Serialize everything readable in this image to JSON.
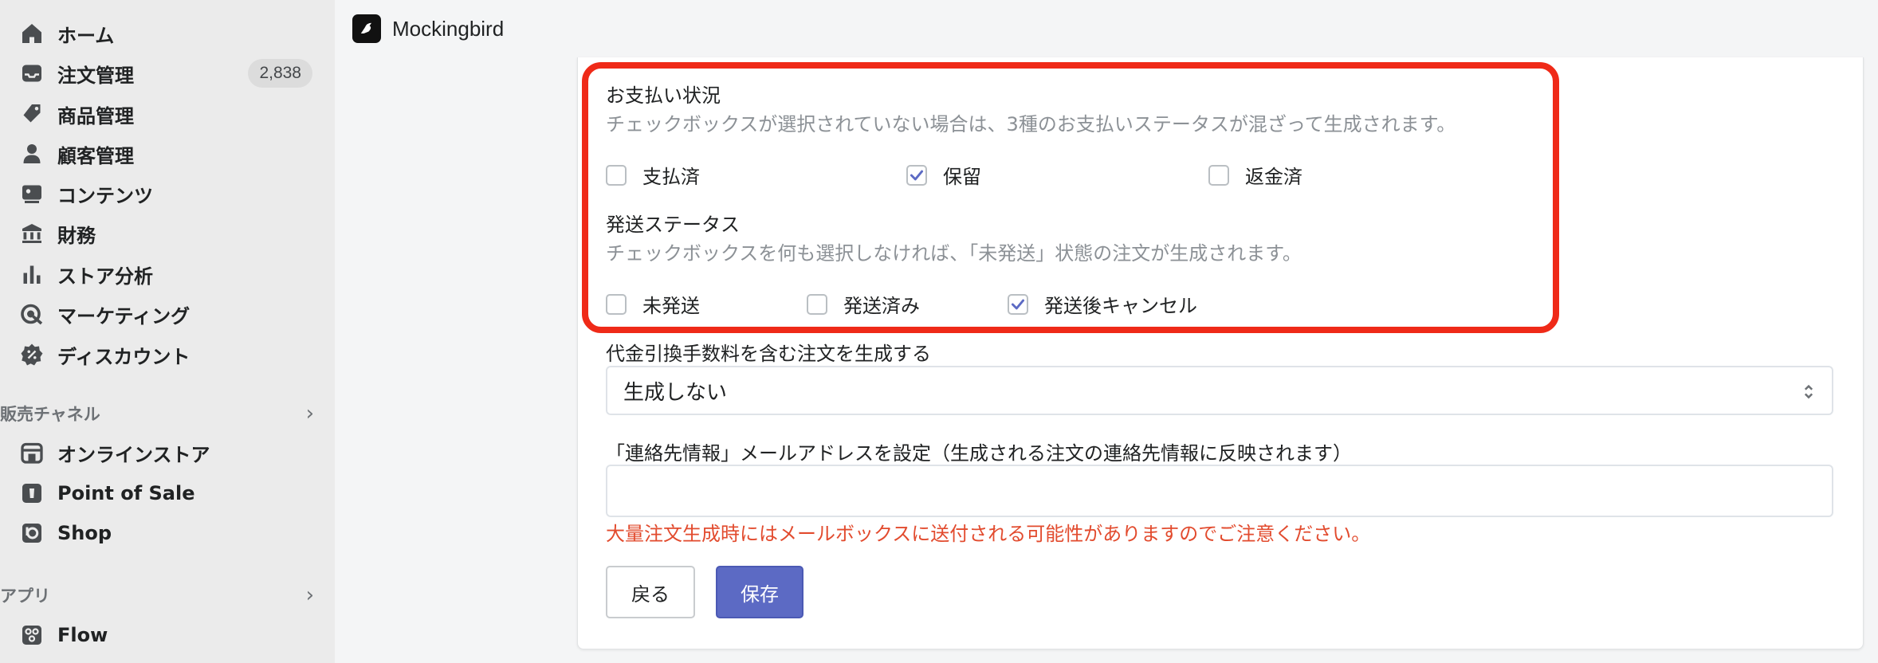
{
  "app": {
    "name": "Mockingbird"
  },
  "sidebar": {
    "items": [
      {
        "label": "ホーム",
        "icon": "home-icon"
      },
      {
        "label": "注文管理",
        "icon": "inbox-icon",
        "badge": "2,838"
      },
      {
        "label": "商品管理",
        "icon": "tag-icon"
      },
      {
        "label": "顧客管理",
        "icon": "person-icon"
      },
      {
        "label": "コンテンツ",
        "icon": "image-icon"
      },
      {
        "label": "財務",
        "icon": "bank-icon"
      },
      {
        "label": "ストア分析",
        "icon": "bar-chart-icon"
      },
      {
        "label": "マーケティング",
        "icon": "target-icon"
      },
      {
        "label": "ディスカウント",
        "icon": "discount-icon"
      }
    ],
    "sales_channels": {
      "title": "販売チャネル",
      "items": [
        {
          "label": "オンラインストア",
          "icon": "store-icon"
        },
        {
          "label": "Point of Sale",
          "icon": "pos-icon"
        },
        {
          "label": "Shop",
          "icon": "shop-icon"
        }
      ]
    },
    "apps": {
      "title": "アプリ",
      "items": [
        {
          "label": "Flow",
          "icon": "flow-icon"
        }
      ]
    }
  },
  "form": {
    "payment": {
      "title": "お支払い状況",
      "help": "チェックボックスが選択されていない場合は、3種のお支払いステータスが混ざって生成されます。",
      "options": [
        {
          "label": "支払済",
          "checked": false
        },
        {
          "label": "保留",
          "checked": true
        },
        {
          "label": "返金済",
          "checked": false
        }
      ]
    },
    "shipping": {
      "title": "発送ステータス",
      "help": "チェックボックスを何も選択しなければ、「未発送」状態の注文が生成されます。",
      "options": [
        {
          "label": "未発送",
          "checked": false
        },
        {
          "label": "発送済み",
          "checked": false
        },
        {
          "label": "発送後キャンセル",
          "checked": true
        }
      ]
    },
    "cod": {
      "label": "代金引換手数料を含む注文を生成する",
      "value": "生成しない"
    },
    "email": {
      "label": "「連絡先情報」メールアドレスを設定（生成される注文の連絡先情報に反映されます）",
      "value": "",
      "warning": "大量注文生成時にはメールボックスに送付される可能性がありますのでご注意ください。"
    },
    "buttons": {
      "back": "戻る",
      "save": "保存"
    }
  },
  "colors": {
    "accent": "#5c6ac4",
    "highlight": "#ef2a18",
    "warning": "#e24b2e",
    "sidebar_bg": "#ebebeb"
  }
}
